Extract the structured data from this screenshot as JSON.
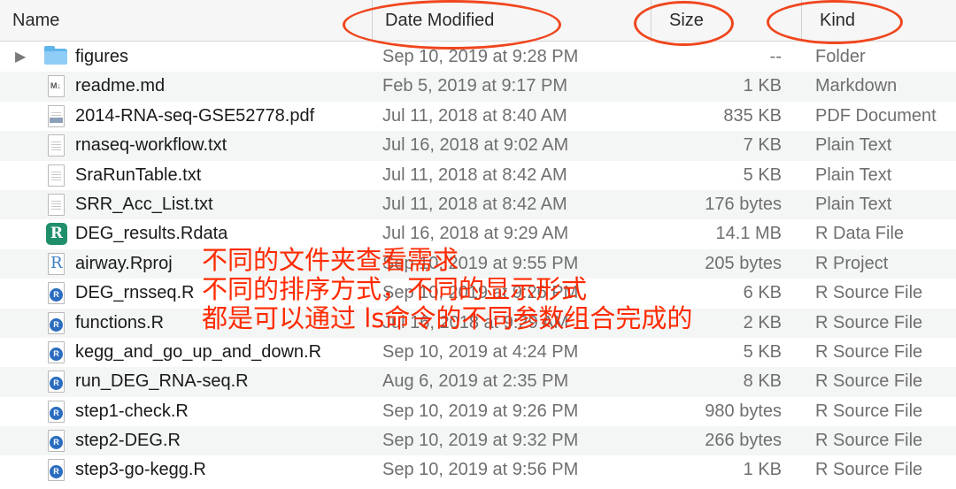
{
  "columns": {
    "name": "Name",
    "date": "Date Modified",
    "size": "Size",
    "kind": "Kind"
  },
  "files": [
    {
      "name": "figures",
      "date": "Sep 10, 2019 at 9:28 PM",
      "size": "--",
      "kind": "Folder",
      "icon": "folder-icon",
      "expandable": true
    },
    {
      "name": "readme.md",
      "date": "Feb 5, 2019 at 9:17 PM",
      "size": "1 KB",
      "kind": "Markdown",
      "icon": "markdown-file-icon"
    },
    {
      "name": "2014-RNA-seq-GSE52778.pdf",
      "date": "Jul 11, 2018 at 8:40 AM",
      "size": "835 KB",
      "kind": "PDF Document",
      "icon": "pdf-file-icon"
    },
    {
      "name": "rnaseq-workflow.txt",
      "date": "Jul 16, 2018 at 9:02 AM",
      "size": "7 KB",
      "kind": "Plain Text",
      "icon": "text-file-icon"
    },
    {
      "name": "SraRunTable.txt",
      "date": "Jul 11, 2018 at 8:42 AM",
      "size": "5 KB",
      "kind": "Plain Text",
      "icon": "text-file-icon"
    },
    {
      "name": "SRR_Acc_List.txt",
      "date": "Jul 11, 2018 at 8:42 AM",
      "size": "176 bytes",
      "kind": "Plain Text",
      "icon": "text-file-icon"
    },
    {
      "name": "DEG_results.Rdata",
      "date": "Jul 16, 2018 at 9:29 AM",
      "size": "14.1 MB",
      "kind": "R Data File",
      "icon": "rdata-file-icon"
    },
    {
      "name": "airway.Rproj",
      "date": "Sep 10, 2019 at 9:55 PM",
      "size": "205 bytes",
      "kind": "R Project",
      "icon": "rproj-file-icon"
    },
    {
      "name": "DEG_rnsseq.R",
      "date": "Sep 10, 2019 at 9:26 PM",
      "size": "6 KB",
      "kind": "R Source File",
      "icon": "r-source-file-icon"
    },
    {
      "name": "functions.R",
      "date": "Jul 16, 2018 at 9:29 AM",
      "size": "2 KB",
      "kind": "R Source File",
      "icon": "r-source-file-icon"
    },
    {
      "name": "kegg_and_go_up_and_down.R",
      "date": "Sep 10, 2019 at 4:24 PM",
      "size": "5 KB",
      "kind": "R Source File",
      "icon": "r-source-file-icon"
    },
    {
      "name": "run_DEG_RNA-seq.R",
      "date": "Aug 6, 2019 at 2:35 PM",
      "size": "8 KB",
      "kind": "R Source File",
      "icon": "r-source-file-icon"
    },
    {
      "name": "step1-check.R",
      "date": "Sep 10, 2019 at 9:26 PM",
      "size": "980 bytes",
      "kind": "R Source File",
      "icon": "r-source-file-icon"
    },
    {
      "name": "step2-DEG.R",
      "date": "Sep 10, 2019 at 9:32 PM",
      "size": "266 bytes",
      "kind": "R Source File",
      "icon": "r-source-file-icon"
    },
    {
      "name": "step3-go-kegg.R",
      "date": "Sep 10, 2019 at 9:56 PM",
      "size": "1 KB",
      "kind": "R Source File",
      "icon": "r-source-file-icon"
    }
  ],
  "annotations": {
    "line1": "不同的文件夹查看需求",
    "line2": "不同的排序方式，不同的显示形式",
    "line3": "都是可以通过 ls命令的不同参数组合完成的",
    "color": "#ff2a00",
    "circle_color": "#f0461e"
  },
  "colors": {
    "header_bg": "#f6f6f6",
    "row_alt": "#f4f5f5",
    "folder": "#5fb4ea",
    "r_badge": "#2a6cbf",
    "rdata": "#1f8f6b"
  }
}
